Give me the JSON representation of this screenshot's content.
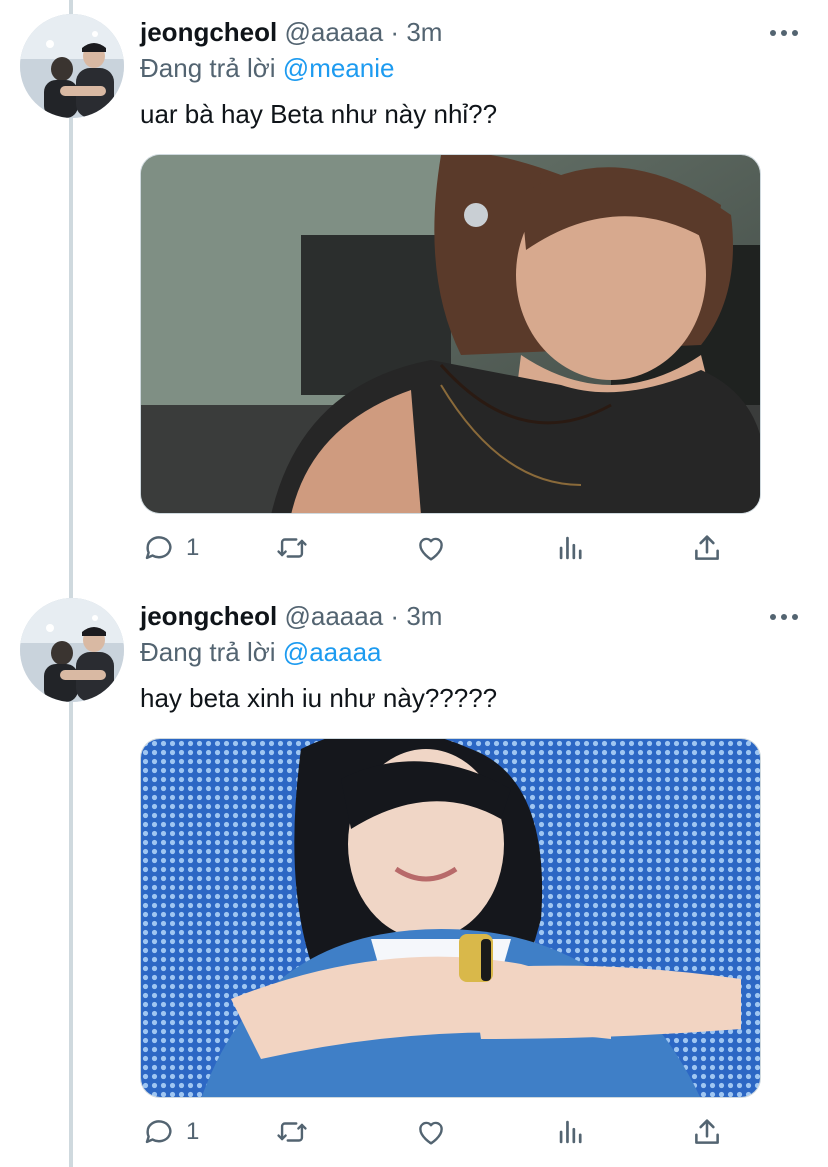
{
  "tweets": [
    {
      "display_name": "jeongcheol",
      "handle": "@aaaaa",
      "separator": "·",
      "time": "3m",
      "reply_prefix": "Đang trả lời",
      "reply_to": "@meanie",
      "text": "uar bà hay Beta như này nhỉ??",
      "media_icon": "photo-concert-sleeveless-shirt",
      "reply_count": "1",
      "retweet_count": "",
      "like_count": ""
    },
    {
      "display_name": "jeongcheol",
      "handle": "@aaaaa",
      "separator": "·",
      "time": "3m",
      "reply_prefix": "Đang trả lời",
      "reply_to": "@aaaaa",
      "text": "hay beta xinh iu như này?????",
      "media_icon": "photo-stage-blue-led-background",
      "reply_count": "1",
      "retweet_count": "",
      "like_count": ""
    }
  ],
  "colors": {
    "text_primary": "#0f1419",
    "text_secondary": "#536471",
    "link": "#1d9bf0",
    "thread_line": "#cfd9de",
    "background": "#ffffff"
  },
  "icons": [
    "reply-icon",
    "retweet-icon",
    "like-icon",
    "analytics-icon",
    "share-icon",
    "more-icon"
  ]
}
